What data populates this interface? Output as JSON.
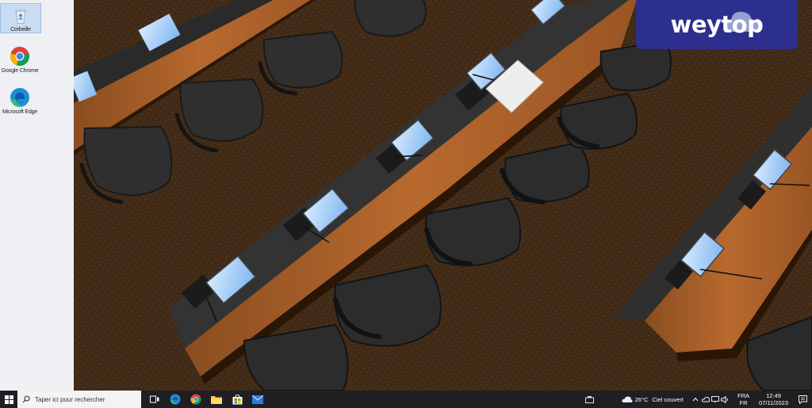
{
  "desktop": {
    "icons": [
      {
        "label": "Corbeille",
        "icon": "recycle-bin-icon"
      },
      {
        "label": "Google Chrome",
        "icon": "chrome-icon"
      },
      {
        "label": "Microsoft Edge",
        "icon": "edge-icon"
      }
    ]
  },
  "logo": {
    "text": "weytop",
    "color": "#2d2f8e"
  },
  "taskbar": {
    "search_placeholder": "Taper ici pour rechercher",
    "pinned": [
      "task-view-icon",
      "edge-icon",
      "chrome-icon",
      "file-explorer-icon",
      "store-icon",
      "mail-icon"
    ],
    "weather": {
      "temperature": "26°C",
      "condition": "Ciel couvert"
    },
    "language": {
      "top": "FRA",
      "bottom": "FR"
    },
    "clock": {
      "time": "12:49",
      "date": "07/11/2023"
    },
    "background": "#1f1f23"
  }
}
